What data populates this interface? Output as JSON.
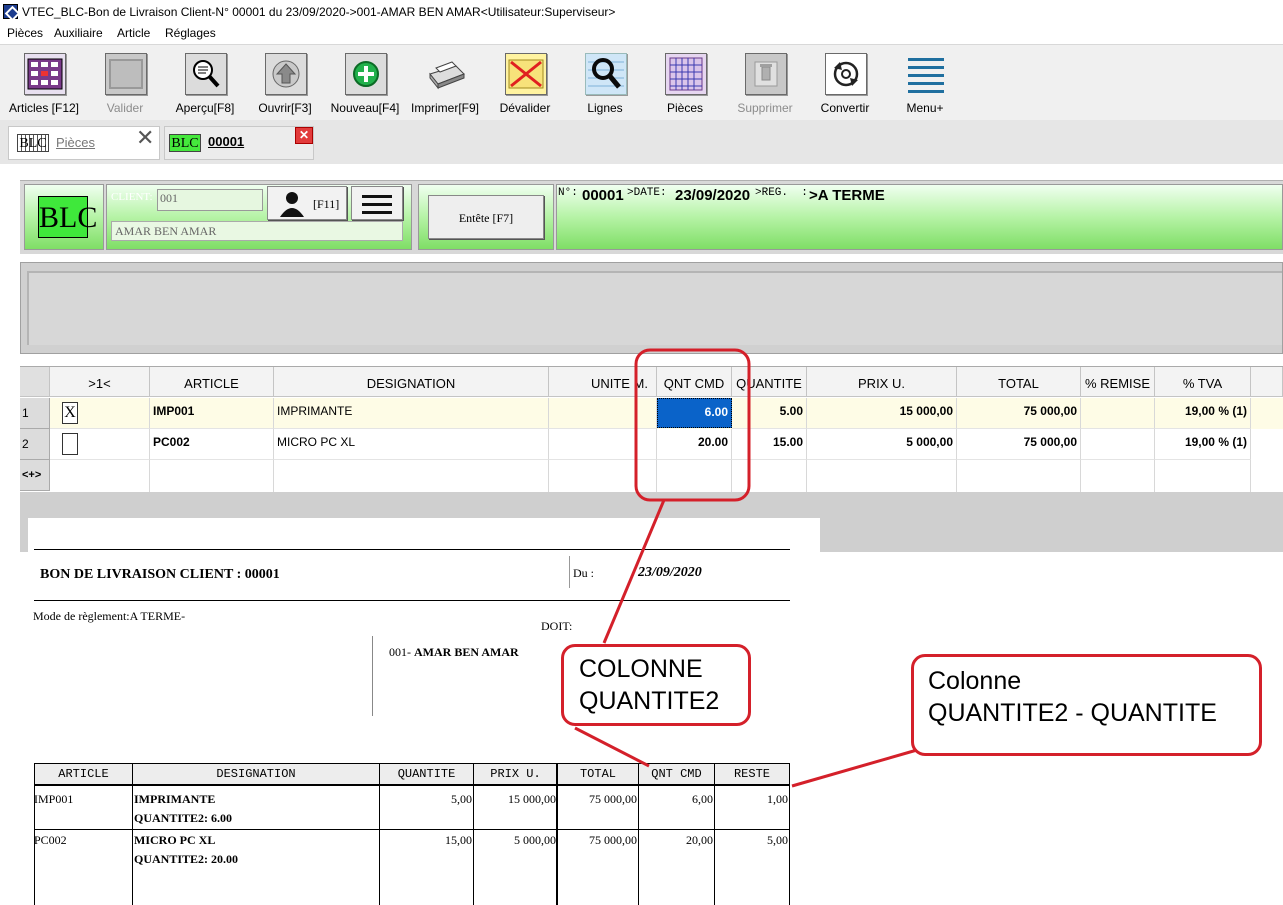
{
  "window": {
    "title": "VTEC_BLC-Bon de Livraison Client-N° 00001 du 23/09/2020->001-AMAR BEN AMAR<Utilisateur:Superviseur>"
  },
  "menu": [
    "Pièces",
    "Auxiliaire",
    "Article",
    "Réglages"
  ],
  "toolbar": {
    "articles": "Articles [F12]",
    "valider": "Valider",
    "apercu": "Aperçu[F8]",
    "ouvrir": "Ouvrir[F3]",
    "nouveau": "Nouveau[F4]",
    "imprimer": "Imprimer[F9]",
    "devalider": "Dévalider",
    "lignes": "Lignes",
    "pieces": "Pièces",
    "supprimer": "Supprimer",
    "convertir": "Convertir",
    "menu": "Menu+"
  },
  "tabs": {
    "pieces_icon": "BLC",
    "pieces_label": "Pièces",
    "doc_icon": "BLC",
    "doc_label": "00001"
  },
  "header": {
    "doc_type": "BLC",
    "client_label": "CLIENT:",
    "client_code": "001",
    "client_name": "AMAR BEN AMAR",
    "f11_label": "[F11]",
    "entete_button": "Entête [F7]",
    "info": {
      "no_label": "N°:",
      "no_value": "00001",
      "date_label": ">DATE:",
      "date_value": "23/09/2020",
      "reg_label": ">REG.  :",
      "reg_value": ">A TERME"
    }
  },
  "grid": {
    "selector_header": ">1<",
    "columns": [
      "ARTICLE",
      "DESIGNATION",
      "UNITE M.",
      "QNT CMD",
      "QUANTITE",
      "PRIX U.",
      "TOTAL",
      "% REMISE",
      "% TVA"
    ],
    "rows": [
      {
        "num": "1",
        "checked": "X",
        "article": "IMP001",
        "designation": "IMPRIMANTE",
        "unite": "",
        "qnt_cmd": "6.00",
        "quantite": "5.00",
        "prix": "15 000,00",
        "total": "75 000,00",
        "remise": "",
        "tva": "19,00 % (1)"
      },
      {
        "num": "2",
        "checked": "",
        "article": "PC002",
        "designation": "MICRO PC XL",
        "unite": "",
        "qnt_cmd": "20.00",
        "quantite": "15.00",
        "prix": "5 000,00",
        "total": "75 000,00",
        "remise": "",
        "tva": "19,00 % (1)"
      }
    ],
    "new_row_marker": "<+>"
  },
  "report": {
    "title": "BON DE LIVRAISON CLIENT : 00001",
    "du_label": "Du :",
    "date": "23/09/2020",
    "mode_reglement": "Mode de règlement:A TERME-",
    "doit_label": "DOIT:",
    "client_code": "001-",
    "client_name": "AMAR BEN AMAR",
    "columns": [
      "ARTICLE",
      "DESIGNATION",
      "QUANTITE",
      "PRIX U.",
      "TOTAL",
      "QNT CMD",
      "RESTE"
    ],
    "rows": [
      {
        "article": "IMP001",
        "designation": "IMPRIMANTE",
        "sub": "QUANTITE2: 6.00",
        "quantite": "5,00",
        "prix": "15 000,00",
        "total": "75 000,00",
        "qnt_cmd": "6,00",
        "reste": "1,00"
      },
      {
        "article": "PC002",
        "designation": "MICRO PC XL",
        "sub": "QUANTITE2: 20.00",
        "quantite": "15,00",
        "prix": "5 000,00",
        "total": "75 000,00",
        "qnt_cmd": "20,00",
        "reste": "5,00"
      }
    ]
  },
  "annotations": {
    "callout1_line1": "COLONNE",
    "callout1_line2": "QUANTITE2",
    "callout2_line1": "Colonne",
    "callout2_line2": "QUANTITE2 - QUANTITE",
    "color": "#d4202a"
  }
}
